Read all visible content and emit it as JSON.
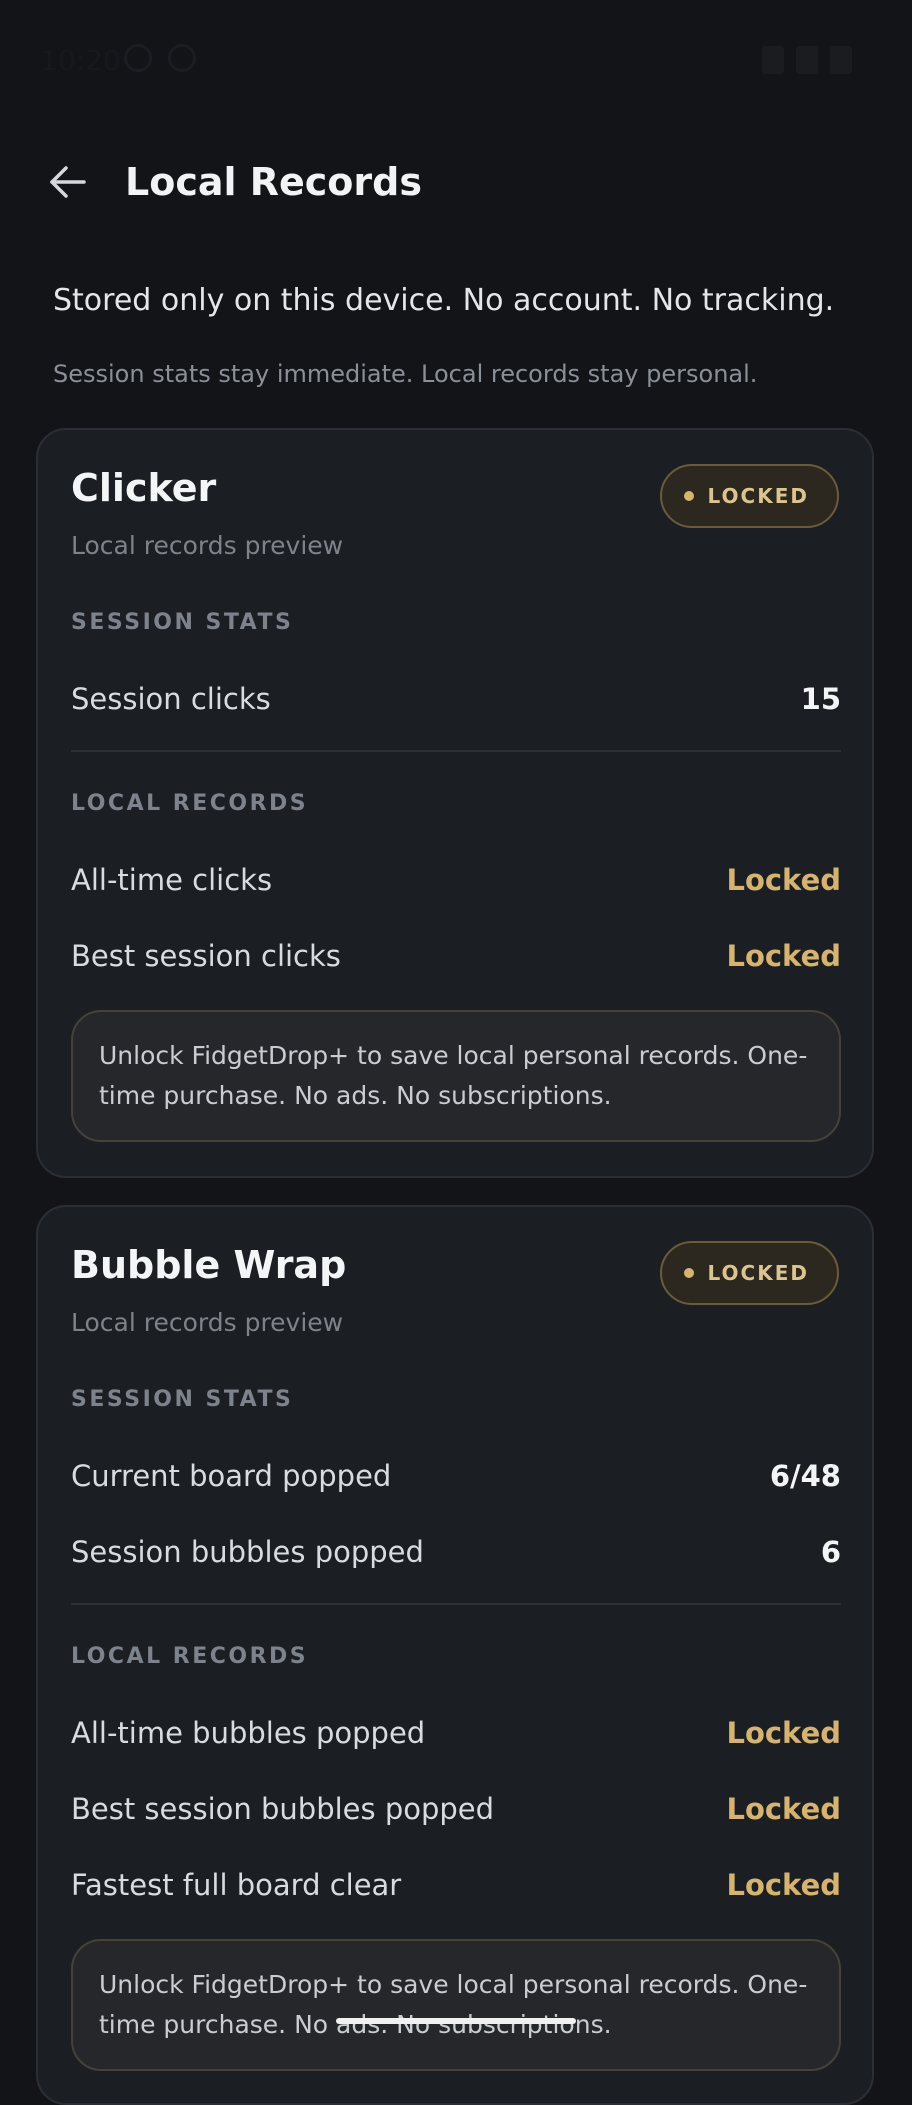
{
  "status_bar": {
    "time": "10:20"
  },
  "app_bar": {
    "title": "Local Records",
    "back_icon": "arrow-left-icon"
  },
  "intro": {
    "main": "Stored only on this device. No account. No tracking.",
    "sub": "Session stats stay immediate. Local records stay personal."
  },
  "colors": {
    "background": "#121418",
    "card": "#1b1e23",
    "locked_accent": "#d6b46e"
  },
  "cards": [
    {
      "title": "Clicker",
      "subtitle": "Local records preview",
      "badge": "LOCKED",
      "session_label": "SESSION STATS",
      "session_rows": [
        {
          "label": "Session clicks",
          "value": "15"
        }
      ],
      "records_label": "LOCAL RECORDS",
      "record_rows": [
        {
          "label": "All-time clicks",
          "value": "Locked"
        },
        {
          "label": "Best session clicks",
          "value": "Locked"
        }
      ],
      "notice": "Unlock FidgetDrop+ to save local personal records. One-time purchase. No ads. No subscriptions."
    },
    {
      "title": "Bubble Wrap",
      "subtitle": "Local records preview",
      "badge": "LOCKED",
      "session_label": "SESSION STATS",
      "session_rows": [
        {
          "label": "Current board popped",
          "value": "6/48"
        },
        {
          "label": "Session bubbles popped",
          "value": "6"
        }
      ],
      "records_label": "LOCAL RECORDS",
      "record_rows": [
        {
          "label": "All-time bubbles popped",
          "value": "Locked"
        },
        {
          "label": "Best session bubbles popped",
          "value": "Locked"
        },
        {
          "label": "Fastest full board clear",
          "value": "Locked"
        }
      ],
      "notice": "Unlock FidgetDrop+ to save local personal records. One-time purchase. No ads. No subscriptions."
    }
  ]
}
